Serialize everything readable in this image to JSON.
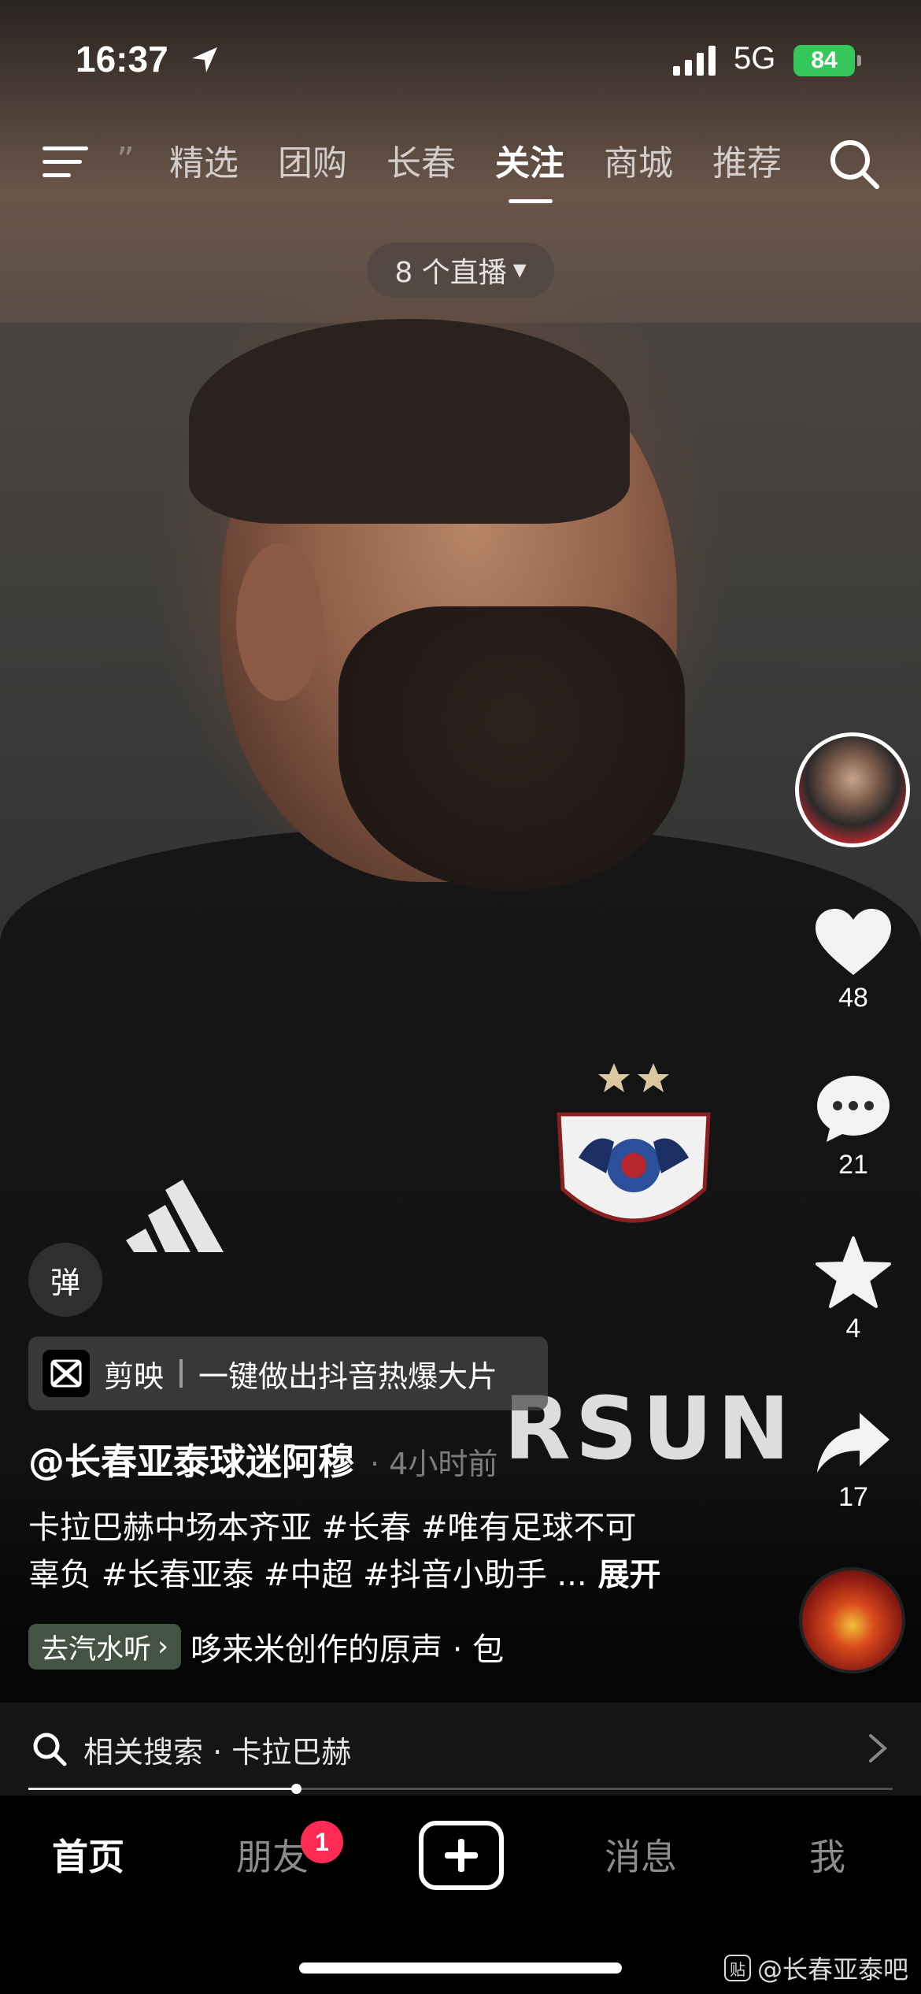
{
  "status_bar": {
    "time": "16:37",
    "network": "5G",
    "battery": "84"
  },
  "top_nav": {
    "side_glyph": "”",
    "tabs": [
      "精选",
      "团购",
      "长春",
      "关注",
      "商城",
      "推荐"
    ],
    "active_tab": "关注"
  },
  "live_pill": {
    "label": "8 个直播"
  },
  "video": {
    "sponsor_text": "RSUN"
  },
  "right_rail": {
    "like_count": "48",
    "comment_count": "21",
    "favorite_count": "4",
    "share_count": "17"
  },
  "danmu": {
    "label": "弹"
  },
  "capcut": {
    "name": "剪映",
    "slogan": "一键做出抖音热爆大片"
  },
  "post": {
    "author": "@长春亚泰球迷阿穆",
    "time_ago": "· 4小时前",
    "description_line1": "卡拉巴赫中场本齐亚 #长春 #唯有足球不可",
    "description_line2": "辜负 #长春亚泰 #中超 #抖音小助手 ...",
    "expand_label": "展开"
  },
  "music": {
    "pill_label": "去汽水听",
    "text": "哆来米创作的原声 · 包"
  },
  "related_search": {
    "label": "相关搜索 · 卡拉巴赫"
  },
  "progress": {
    "fraction": 0.31
  },
  "tabbar": {
    "home": "首页",
    "friends": "朋友",
    "friends_badge": "1",
    "messages": "消息",
    "me": "我"
  },
  "watermark": {
    "icon_text": "贴",
    "label": "@长春亚泰吧"
  }
}
